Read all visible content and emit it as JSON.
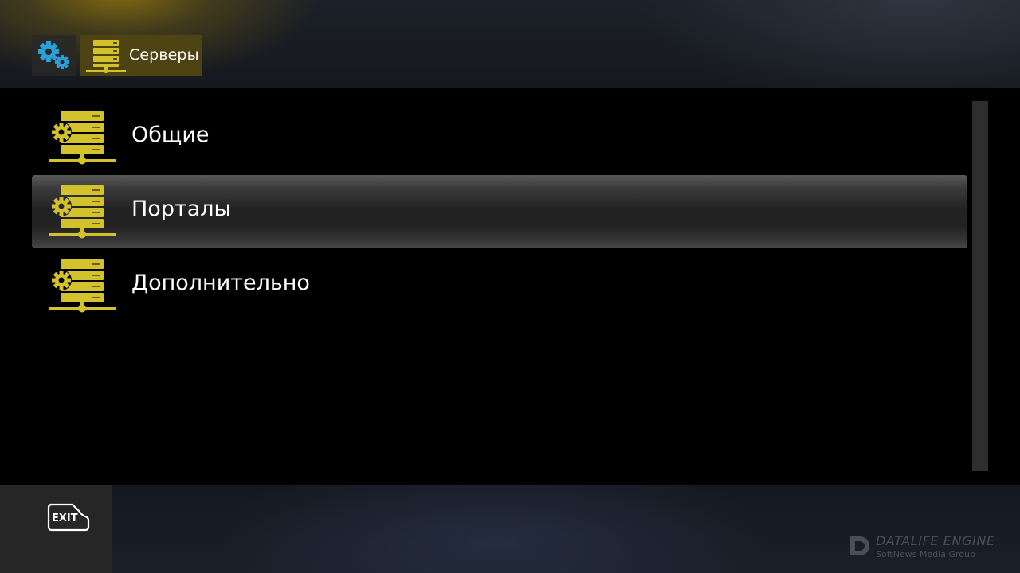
{
  "header": {
    "breadcrumb": [
      {
        "icon": "gears-icon"
      },
      {
        "icon": "server-icon",
        "label": "Серверы"
      }
    ]
  },
  "menu": {
    "selected_index": 1,
    "items": [
      {
        "label": "Общие",
        "icon": "server-settings-icon"
      },
      {
        "label": "Порталы",
        "icon": "server-settings-icon"
      },
      {
        "label": "Дополнительно",
        "icon": "server-settings-icon"
      }
    ]
  },
  "footer": {
    "exit_label": "EXIT",
    "watermark": {
      "title": "DATALIFE ENGINE",
      "subtitle": "SoftNews Media Group"
    }
  },
  "colors": {
    "accent_yellow": "#d4c22c",
    "gear_blue": "#2a9fd8",
    "selected_row": "#2a2a2a"
  }
}
